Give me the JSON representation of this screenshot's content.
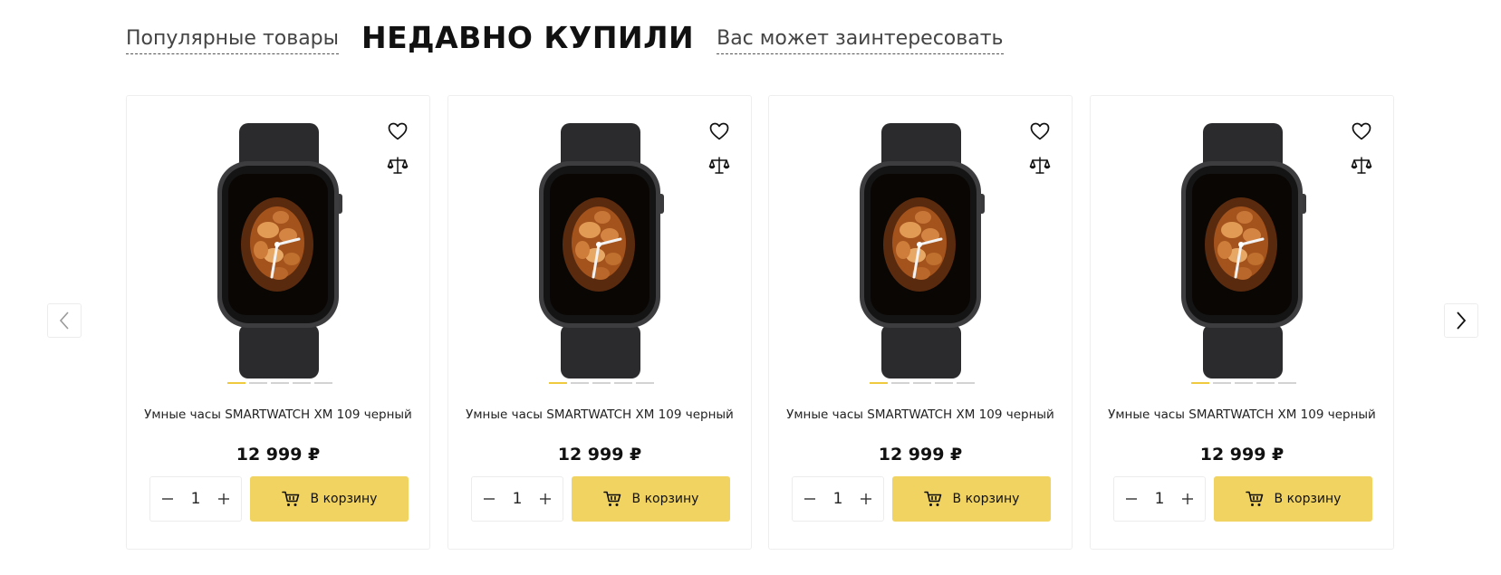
{
  "tabs": [
    {
      "label": "Популярные товары",
      "active": false
    },
    {
      "label": "НЕДАВНО КУПИЛИ",
      "active": true
    },
    {
      "label": "Вас может заинтересовать",
      "active": false
    }
  ],
  "products": [
    {
      "name": "Умные часы SMARTWATCH XM 109 черный",
      "price": "12 999 ₽",
      "qty": "1",
      "cart_label": "В корзину",
      "gallery_dots": 5,
      "active_dot": 1
    },
    {
      "name": "Умные часы SMARTWATCH XM 109 черный",
      "price": "12 999 ₽",
      "qty": "1",
      "cart_label": "В корзину",
      "gallery_dots": 5,
      "active_dot": 1
    },
    {
      "name": "Умные часы SMARTWATCH XM 109 черный",
      "price": "12 999 ₽",
      "qty": "1",
      "cart_label": "В корзину",
      "gallery_dots": 5,
      "active_dot": 1
    },
    {
      "name": "Умные часы SMARTWATCH XM 109 черный",
      "price": "12 999 ₽",
      "qty": "1",
      "cart_label": "В корзину",
      "gallery_dots": 5,
      "active_dot": 1
    }
  ],
  "icons": {
    "favorite": "heart-icon",
    "compare": "scales-icon",
    "decrease": "minus-icon",
    "increase": "plus-icon",
    "cart": "cart-icon",
    "prev": "chevron-left-icon",
    "next": "chevron-right-icon"
  },
  "colors": {
    "accent": "#f1d362",
    "active_dot": "#efc93e",
    "inactive_dot": "#d3d3d3",
    "card_border": "#eeeeee"
  }
}
